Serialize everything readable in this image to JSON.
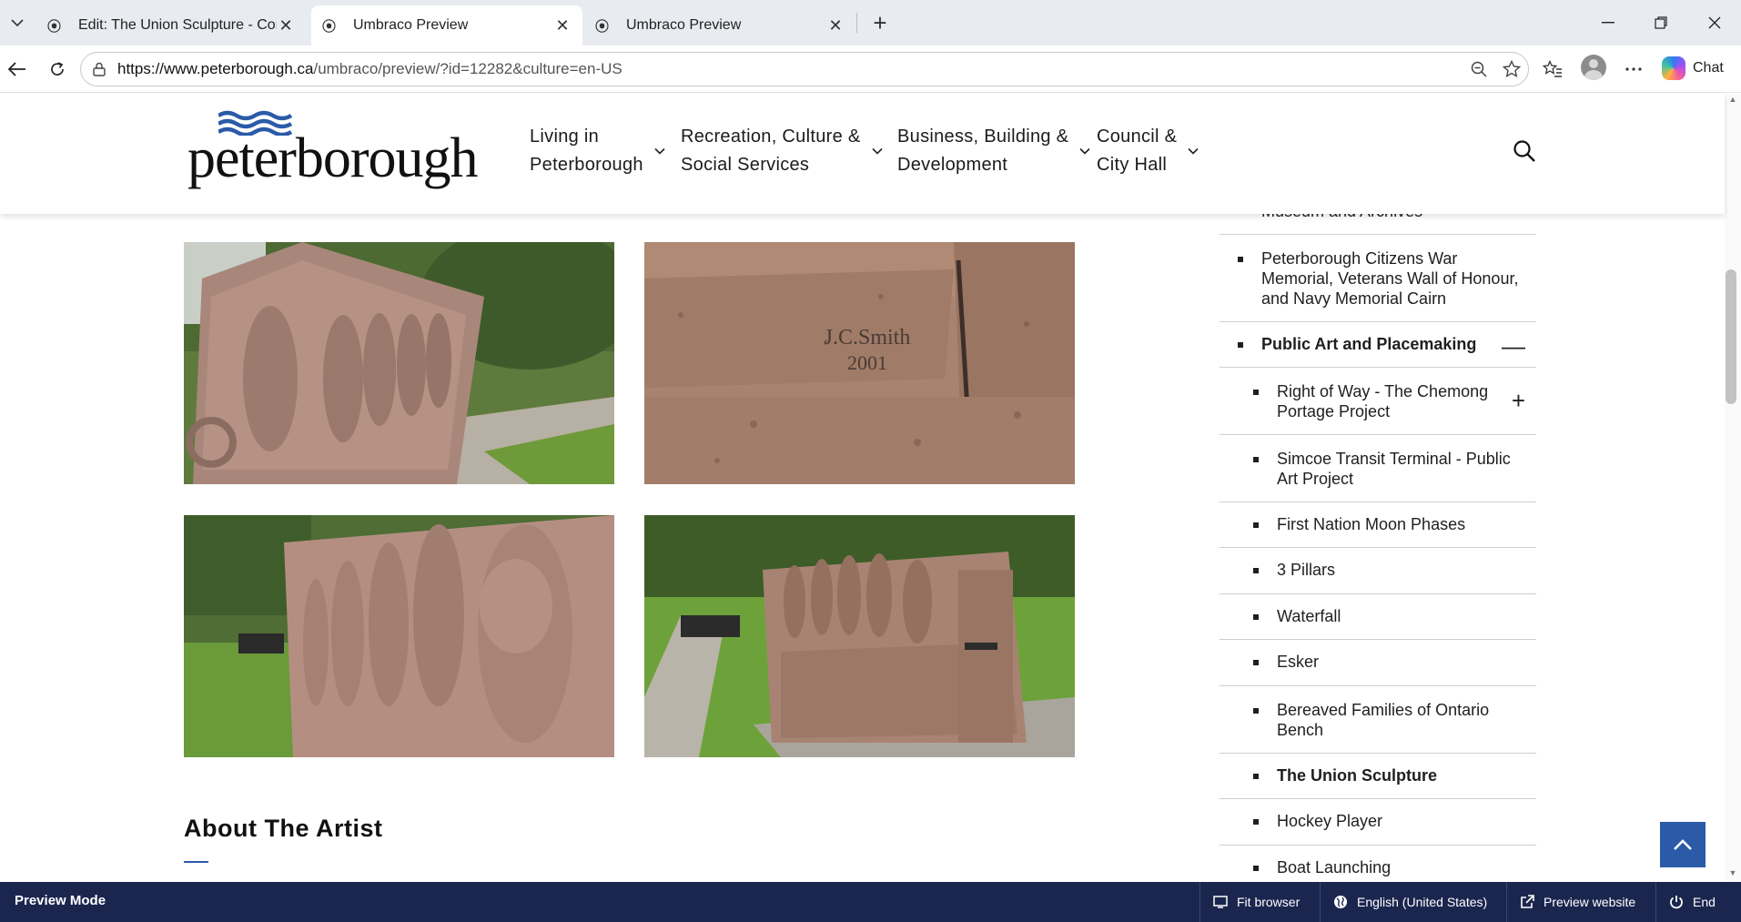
{
  "browser": {
    "tabs": [
      {
        "title": "Edit: The Union Sculpture - Conten",
        "favicon": "umbraco-icon",
        "active": false
      },
      {
        "title": "Umbraco Preview",
        "favicon": "umbraco-icon",
        "active": true
      },
      {
        "title": "Umbraco Preview",
        "favicon": "umbraco-icon",
        "active": false
      }
    ],
    "url_host": "https://www.peterborough.ca",
    "url_path": "/umbraco/preview/?id=12282&culture=en-US",
    "chat_label": "Chat"
  },
  "site": {
    "logo_text": "peterborough",
    "nav": [
      {
        "line1": "Living in",
        "line2": "Peterborough"
      },
      {
        "line1": "Recreation, Culture &",
        "line2": "Social Services"
      },
      {
        "line1": "Business, Building &",
        "line2": "Development"
      },
      {
        "line1": "Council &",
        "line2": "City Hall"
      }
    ]
  },
  "gallery": {
    "images": [
      {
        "alt": "sculpture-side-relief-photo"
      },
      {
        "alt": "sculpture-signature-photo",
        "engraving_line1": "J.C.Smith",
        "engraving_line2": "2001"
      },
      {
        "alt": "sculpture-faces-closeup-photo"
      },
      {
        "alt": "sculpture-park-view-photo"
      }
    ]
  },
  "main": {
    "artist_heading": "About The Artist"
  },
  "sidebar": {
    "items": [
      {
        "label": "Museum and Archives",
        "level": 1,
        "bold": false,
        "toggle": "+"
      },
      {
        "label": "Peterborough Citizens War Memorial, Veterans Wall of Honour, and Navy Memorial Cairn",
        "level": 1,
        "bold": false,
        "toggle": ""
      },
      {
        "label": "Public Art and Placemaking",
        "level": 1,
        "bold": true,
        "toggle": "—"
      },
      {
        "label": "Right of Way - The Chemong Portage Project",
        "level": 2,
        "bold": false,
        "toggle": "+"
      },
      {
        "label": "Simcoe Transit Terminal - Public Art Project",
        "level": 2,
        "bold": false,
        "toggle": ""
      },
      {
        "label": "First Nation Moon Phases",
        "level": 2,
        "bold": false,
        "toggle": ""
      },
      {
        "label": "3 Pillars",
        "level": 2,
        "bold": false,
        "toggle": ""
      },
      {
        "label": "Waterfall",
        "level": 2,
        "bold": false,
        "toggle": ""
      },
      {
        "label": "Esker",
        "level": 2,
        "bold": false,
        "toggle": ""
      },
      {
        "label": "Bereaved Families of Ontario Bench",
        "level": 2,
        "bold": false,
        "toggle": ""
      },
      {
        "label": "The Union Sculpture",
        "level": 2,
        "bold": true,
        "toggle": ""
      },
      {
        "label": "Hockey Player",
        "level": 2,
        "bold": false,
        "toggle": ""
      },
      {
        "label": "Boat Launching",
        "level": 2,
        "bold": false,
        "toggle": ""
      }
    ]
  },
  "preview_bar": {
    "title": "Preview Mode",
    "fit_browser": "Fit browser",
    "language": "English (United States)",
    "preview_website": "Preview website",
    "end": "End"
  },
  "colors": {
    "brand_blue": "#2b5aa8",
    "preview_bar": "#1b264f"
  }
}
